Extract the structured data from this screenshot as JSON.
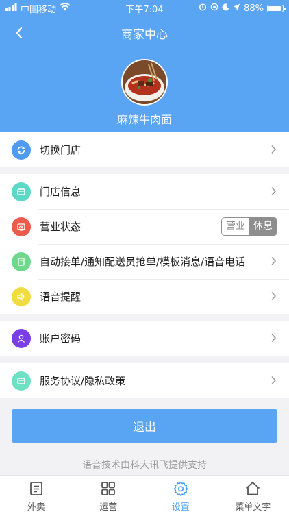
{
  "status_bar": {
    "carrier": "中国移动",
    "time": "下午7:04",
    "battery": "88%",
    "battery_level": 0.88
  },
  "nav": {
    "title": "商家中心"
  },
  "shop": {
    "name": "麻辣牛肉面"
  },
  "groups": {
    "g1": [
      {
        "label": "切换门店",
        "icon": "switch-icon",
        "color": "#4e9bf0"
      }
    ],
    "g2": [
      {
        "label": "门店信息",
        "icon": "store-icon",
        "color": "#5ed8c6"
      },
      {
        "label": "营业状态",
        "icon": "business-status-icon",
        "color": "#ee5a4b"
      },
      {
        "label": "自动接单/通知配送员抢单/模板消息/语音电话",
        "icon": "order-icon",
        "color": "#6ed98d"
      },
      {
        "label": "语音提醒",
        "icon": "voice-icon",
        "color": "#f1dc3f"
      }
    ],
    "g3": [
      {
        "label": "账户密码",
        "icon": "account-icon",
        "color": "#7a3de6"
      }
    ],
    "g4": [
      {
        "label": "服务协议/隐私政策",
        "icon": "agreement-icon",
        "color": "#6ee0c4"
      }
    ]
  },
  "business_toggle": {
    "open": "营业",
    "rest": "休息",
    "selected": "休息"
  },
  "logout": {
    "label": "退出"
  },
  "footer_note": "语音技术由科大讯飞提供支持",
  "tabs": [
    {
      "label": "外卖",
      "icon": "document-icon",
      "active": false
    },
    {
      "label": "运营",
      "icon": "grid-icon",
      "active": false
    },
    {
      "label": "设置",
      "icon": "gear-icon",
      "active": true
    },
    {
      "label": "菜单文字",
      "icon": "home-icon",
      "active": false
    }
  ],
  "colors": {
    "primary": "#5aa5f3",
    "tab_active": "#4a9ff5"
  }
}
